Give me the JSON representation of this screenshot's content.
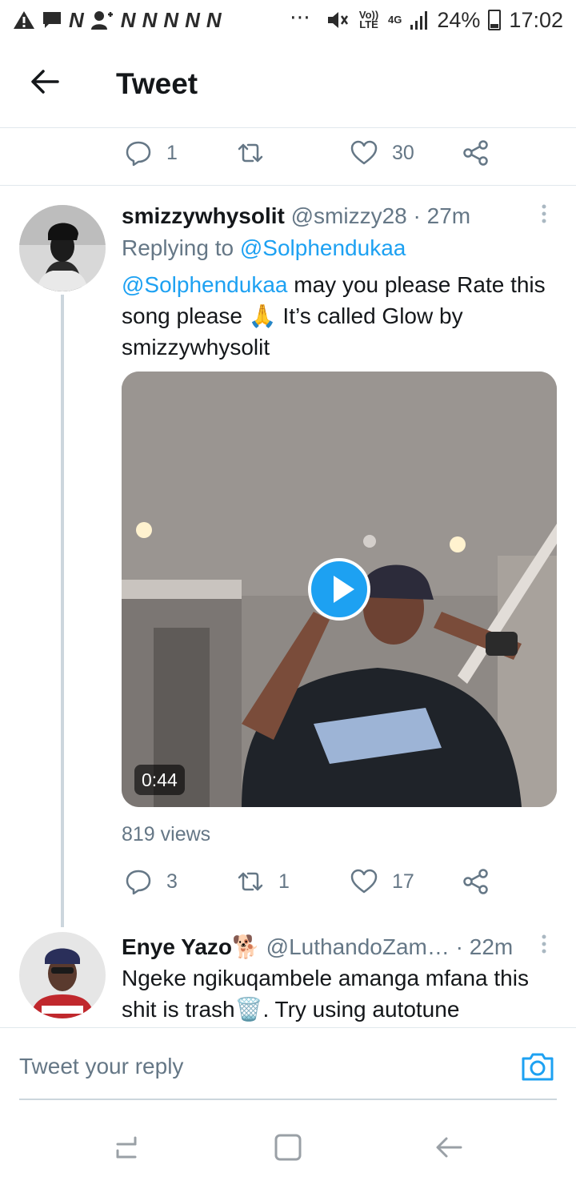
{
  "status_bar": {
    "left_icons": [
      "warning-icon",
      "message-icon",
      "n-icon",
      "contact-add-icon",
      "n-icon",
      "n-icon",
      "n-icon",
      "n-icon",
      "n-icon"
    ],
    "dots": "⋯",
    "volte_label": "Vo)) LTE",
    "network_label": "4G",
    "battery": "24%",
    "time": "17:02"
  },
  "header": {
    "title": "Tweet"
  },
  "main_tweet_actions": {
    "replies": "1",
    "retweets": "",
    "likes": "30"
  },
  "reply1": {
    "display_name": "smizzywhysolit",
    "handle": "@smizzy28",
    "time": "· 27m",
    "replying_label": "Replying to",
    "replying_handle": "@Solphendukaa",
    "mention": "@Solphendukaa",
    "text_1": " may you please Rate this song please 🙏   It’s called Glow by smizzywhysolit",
    "video_duration": "0:44",
    "views": "819 views",
    "replies": "3",
    "retweets": "1",
    "likes": "17"
  },
  "reply2": {
    "display_name": "Enye Yazo🐕",
    "handle": "@LuthandoZam…",
    "time": "· 22m",
    "text": "Ngeke ngikuqambele amanga mfana this shit is trash🗑️. Try using autotune"
  },
  "composer": {
    "placeholder": "Tweet your reply"
  },
  "colors": {
    "accent": "#1da1f2",
    "muted": "#657786",
    "text": "#14171a",
    "border": "#e1e8ed"
  }
}
